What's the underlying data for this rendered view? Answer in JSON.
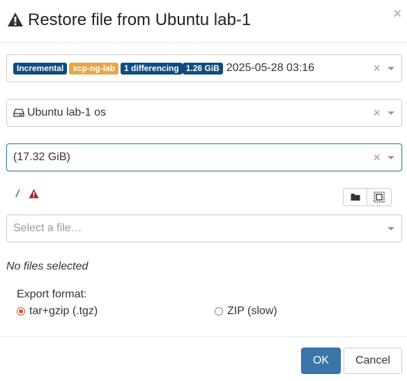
{
  "dialog": {
    "title": "Restore file from Ubuntu lab-1",
    "close_label": "×"
  },
  "backup_select": {
    "badges": [
      {
        "text": "Incremental",
        "color": "#0f4c81"
      },
      {
        "text": "xcp-ng-lab",
        "color": "#e8a744"
      },
      {
        "text": "1 differencing",
        "color": "#0f4c81"
      },
      {
        "text": "1.26 GiB",
        "color": "#0f4c81"
      }
    ],
    "datetime": "2025-05-28 03:16",
    "clear_label": "×"
  },
  "disk_select": {
    "value": "Ubuntu lab-1 os",
    "clear_label": "×"
  },
  "partition_select": {
    "value": "(17.32 GiB)",
    "clear_label": "×"
  },
  "path": {
    "value": "/"
  },
  "file_select": {
    "placeholder": "Select a file…"
  },
  "status": {
    "no_files": "No files selected"
  },
  "export": {
    "label": "Export format:",
    "options": [
      {
        "label": "tar+gzip (.tgz)",
        "checked": true
      },
      {
        "label": "ZIP (slow)",
        "checked": false
      }
    ]
  },
  "footer": {
    "ok_label": "OK",
    "cancel_label": "Cancel"
  },
  "colors": {
    "primary": "#3a75a8",
    "badge_blue": "#0f4c81",
    "badge_orange": "#e8a744",
    "warning_red": "#a51d2d",
    "radio_accent": "#d9531e"
  }
}
